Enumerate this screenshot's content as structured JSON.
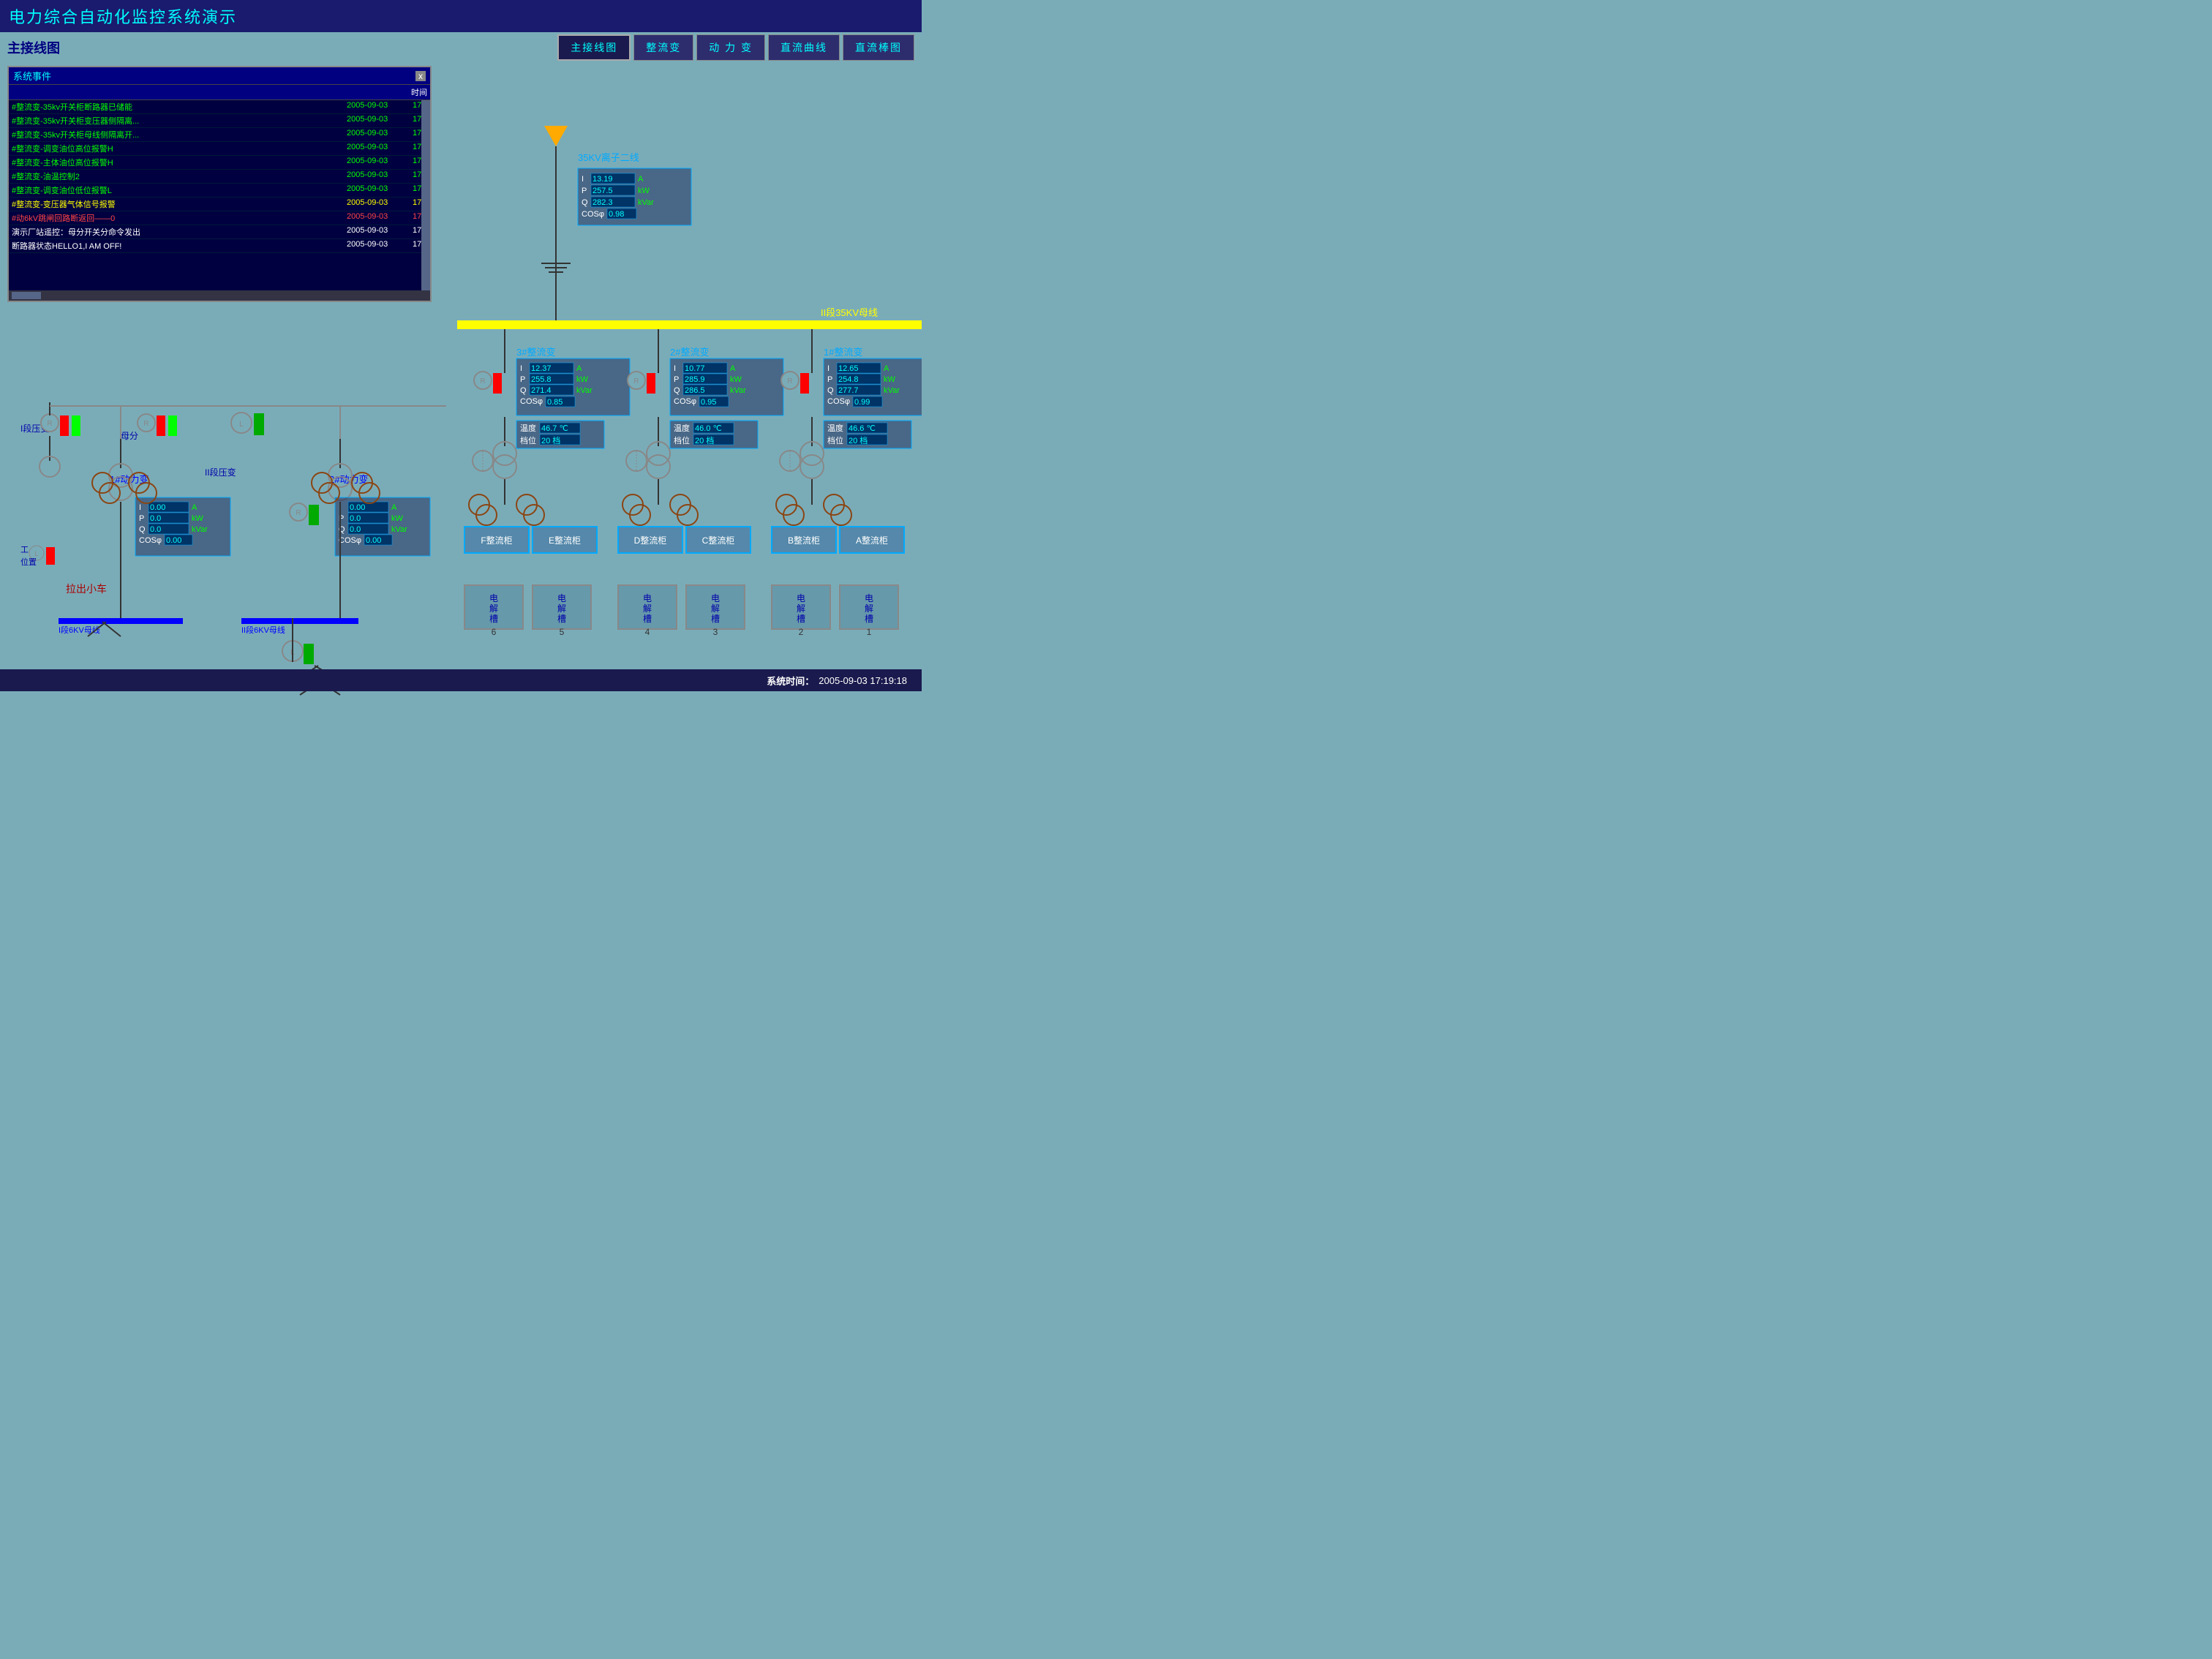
{
  "app": {
    "title": "电力综合自动化监控系统演示",
    "subtitle": "主接线图"
  },
  "nav": {
    "buttons": [
      {
        "label": "主接线图",
        "active": true
      },
      {
        "label": "整流变",
        "active": false
      },
      {
        "label": "动 力 变",
        "active": false
      },
      {
        "label": "直流曲线",
        "active": false
      },
      {
        "label": "直流棒图",
        "active": false
      }
    ]
  },
  "event_window": {
    "title": "系统事件",
    "col_time": "时间",
    "close": "x",
    "events": [
      {
        "msg": "#整流变-35kv开关柜断路器已储能",
        "date": "2005-09-03",
        "time": "17",
        "color": "green"
      },
      {
        "msg": "#整流变-35kv开关柜变压器侧隔离...",
        "date": "2005-09-03",
        "time": "17",
        "color": "green"
      },
      {
        "msg": "#整流变-35kv开关柜母线侧隔离开...",
        "date": "2005-09-03",
        "time": "17",
        "color": "green"
      },
      {
        "msg": "#整流变-调变油位高位报警H",
        "date": "2005-09-03",
        "time": "17",
        "color": "green"
      },
      {
        "msg": "#整流变-主体油位高位报警H",
        "date": "2005-09-03",
        "time": "17",
        "color": "green"
      },
      {
        "msg": "#整流变-油温控制2",
        "date": "2005-09-03",
        "time": "17",
        "color": "green"
      },
      {
        "msg": "#整流变-调变油位低位报警L",
        "date": "2005-09-03",
        "time": "17",
        "color": "green"
      },
      {
        "msg": "#整流变-变压器气体信号报警",
        "date": "2005-09-03",
        "time": "17",
        "color": "yellow"
      },
      {
        "msg": "#动6kV跳闸回路断返回——0",
        "date": "2005-09-03",
        "time": "17",
        "color": "red"
      },
      {
        "msg": "演示厂站遥控：母分开关分命令发出",
        "date": "2005-09-03",
        "time": "17",
        "color": "white"
      },
      {
        "msg": "断路器状态HELLO1,I AM OFF!",
        "date": "2005-09-03",
        "time": "17",
        "color": "white"
      }
    ]
  },
  "line_35kv": {
    "label": "35KV离子二线",
    "params": {
      "I": "13.19 A",
      "P": "257.5 kW",
      "Q": "282.3 kVar",
      "COS": "0.98"
    }
  },
  "bus_35kv_label": "II段35KV母线",
  "rectifiers": [
    {
      "id": "3",
      "label": "3#整流变",
      "I": "12.37 A",
      "P": "255.8 kW",
      "Q": "271.4 kVar",
      "COS": "0.85",
      "temp": "46.7 ℃",
      "档位": "20 档",
      "cabinets": [
        "F整流柜",
        "E整流柜"
      ],
      "tanks": [
        "6",
        "5"
      ]
    },
    {
      "id": "2",
      "label": "2#整流变",
      "I": "10.77 A",
      "P": "285.9 kW",
      "Q": "286.5 kVar",
      "COS": "0.95",
      "temp": "46.0 ℃",
      "档位": "20 档",
      "cabinets": [
        "D整流柜",
        "C整流柜"
      ],
      "tanks": [
        "4",
        "3"
      ]
    },
    {
      "id": "1",
      "label": "1#整流变",
      "I": "12.65 A",
      "P": "254.8 kW",
      "Q": "277.7 kVar",
      "COS": "0.99",
      "temp": "46.6 ℃",
      "档位": "20 档",
      "cabinets": [
        "B整流柜",
        "A整流柜"
      ],
      "tanks": [
        "2",
        "1"
      ]
    }
  ],
  "left_section": {
    "label_yabian": "I段压变",
    "label_mufen": "母分",
    "label_dongli1": "1#动力变",
    "label_dongli2": "2#动力变",
    "label_yadian2": "II段压变",
    "label_chexiao": "拉出小车",
    "label_gongzuo": "工",
    "label_weizhi": "位置",
    "I": "0.00 A",
    "P": "0.0 kW",
    "Q": "0.0 kVar",
    "COS": "0.00",
    "I2": "0.00 A",
    "P2": "0.0 kW",
    "Q2": "0.0 kVar",
    "COS2": "0.00",
    "bus6kv1": "I段6KV母线",
    "bus6kv2": "II段6KV母线"
  },
  "status_bar": {
    "label": "系统时间：",
    "value": "2005-09-03  17:19:18"
  }
}
